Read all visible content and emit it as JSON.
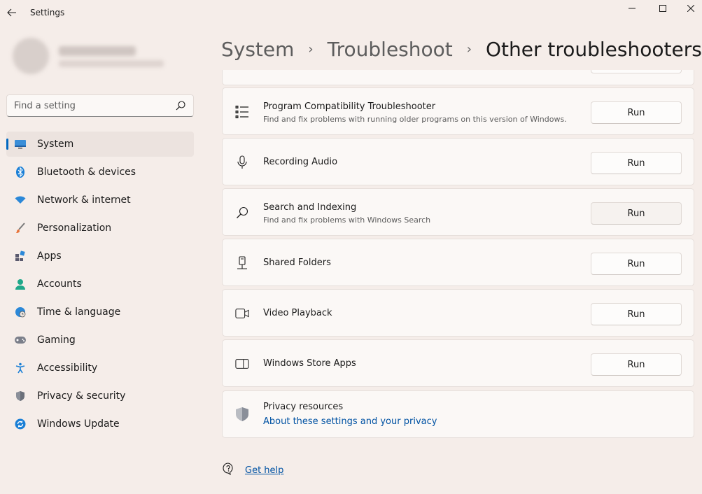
{
  "window": {
    "title": "Settings",
    "controls": [
      "minimize",
      "maximize",
      "close"
    ]
  },
  "search": {
    "placeholder": "Find a setting"
  },
  "sidebar": {
    "items": [
      {
        "label": "System",
        "icon": "system-icon",
        "active": true
      },
      {
        "label": "Bluetooth & devices",
        "icon": "bluetooth-icon"
      },
      {
        "label": "Network & internet",
        "icon": "wifi-icon"
      },
      {
        "label": "Personalization",
        "icon": "brush-icon"
      },
      {
        "label": "Apps",
        "icon": "apps-icon"
      },
      {
        "label": "Accounts",
        "icon": "person-icon"
      },
      {
        "label": "Time & language",
        "icon": "globe-clock-icon"
      },
      {
        "label": "Gaming",
        "icon": "gamepad-icon"
      },
      {
        "label": "Accessibility",
        "icon": "accessibility-icon"
      },
      {
        "label": "Privacy & security",
        "icon": "shield-icon"
      },
      {
        "label": "Windows Update",
        "icon": "update-icon"
      }
    ]
  },
  "breadcrumb": {
    "items": [
      "System",
      "Troubleshoot",
      "Other troubleshooters"
    ]
  },
  "troubleshooters": [
    {
      "title": "Program Compatibility Troubleshooter",
      "description": "Find and fix problems with running older programs on this version of Windows.",
      "icon": "list-icon",
      "button": "Run"
    },
    {
      "title": "Recording Audio",
      "description": "",
      "icon": "microphone-icon",
      "button": "Run"
    },
    {
      "title": "Search and Indexing",
      "description": "Find and fix problems with Windows Search",
      "icon": "search-icon",
      "button": "Run",
      "hovered": true
    },
    {
      "title": "Shared Folders",
      "description": "",
      "icon": "shared-folder-icon",
      "button": "Run"
    },
    {
      "title": "Video Playback",
      "description": "",
      "icon": "video-camera-icon",
      "button": "Run"
    },
    {
      "title": "Windows Store Apps",
      "description": "",
      "icon": "store-window-icon",
      "button": "Run"
    }
  ],
  "privacy": {
    "title": "Privacy resources",
    "link": "About these settings and your privacy",
    "icon": "shield-icon"
  },
  "help": {
    "label": "Get help",
    "icon": "help-chat-icon"
  },
  "colors": {
    "accent": "#0067c0",
    "link": "#0052a3",
    "background": "#f5ede9",
    "card": "#fbf8f6"
  }
}
